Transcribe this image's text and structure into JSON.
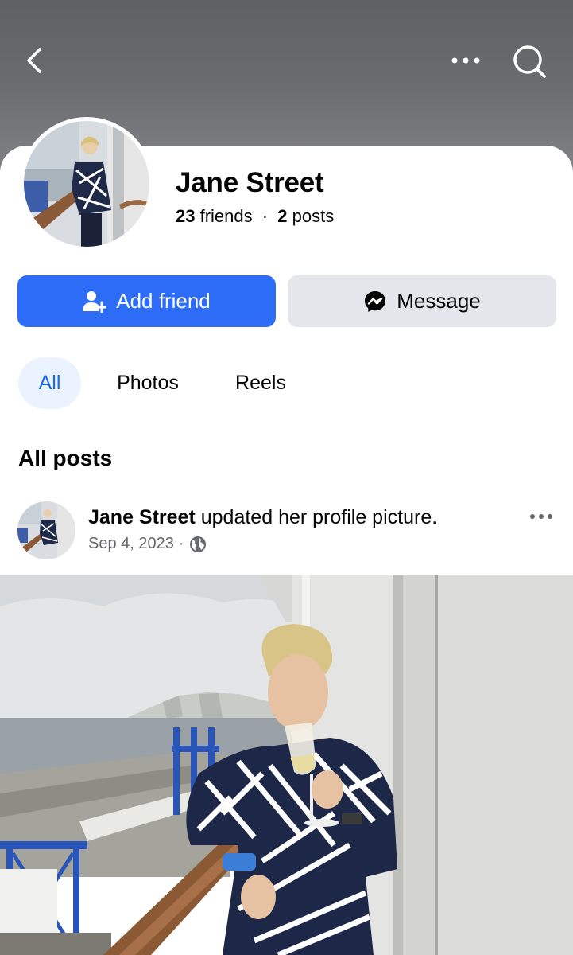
{
  "header": {
    "back_icon": "chevron-left-icon",
    "more_icon": "more-horizontal-icon",
    "search_icon": "search-icon"
  },
  "profile": {
    "name": "Jane Street",
    "friends_count": "23",
    "friends_label": "friends",
    "separator": "·",
    "posts_count": "2",
    "posts_label": "posts"
  },
  "actions": {
    "add_friend_label": "Add friend",
    "add_friend_icon": "add-person-icon",
    "message_label": "Message",
    "message_icon": "messenger-icon"
  },
  "tabs": [
    {
      "label": "All",
      "selected": true
    },
    {
      "label": "Photos",
      "selected": false
    },
    {
      "label": "Reels",
      "selected": false
    }
  ],
  "posts_section": {
    "title": "All posts"
  },
  "post": {
    "author": "Jane Street",
    "action_text": "updated her profile picture.",
    "date": "Sep 4, 2023",
    "separator": "·",
    "privacy_icon": "globe-icon"
  },
  "colors": {
    "primary_blue": "#2d6cf6",
    "tab_selected_bg": "#ebf3ff",
    "tab_selected_text": "#1b6ae3",
    "secondary_button_bg": "#e5e6eb",
    "meta_text": "#65676b"
  }
}
